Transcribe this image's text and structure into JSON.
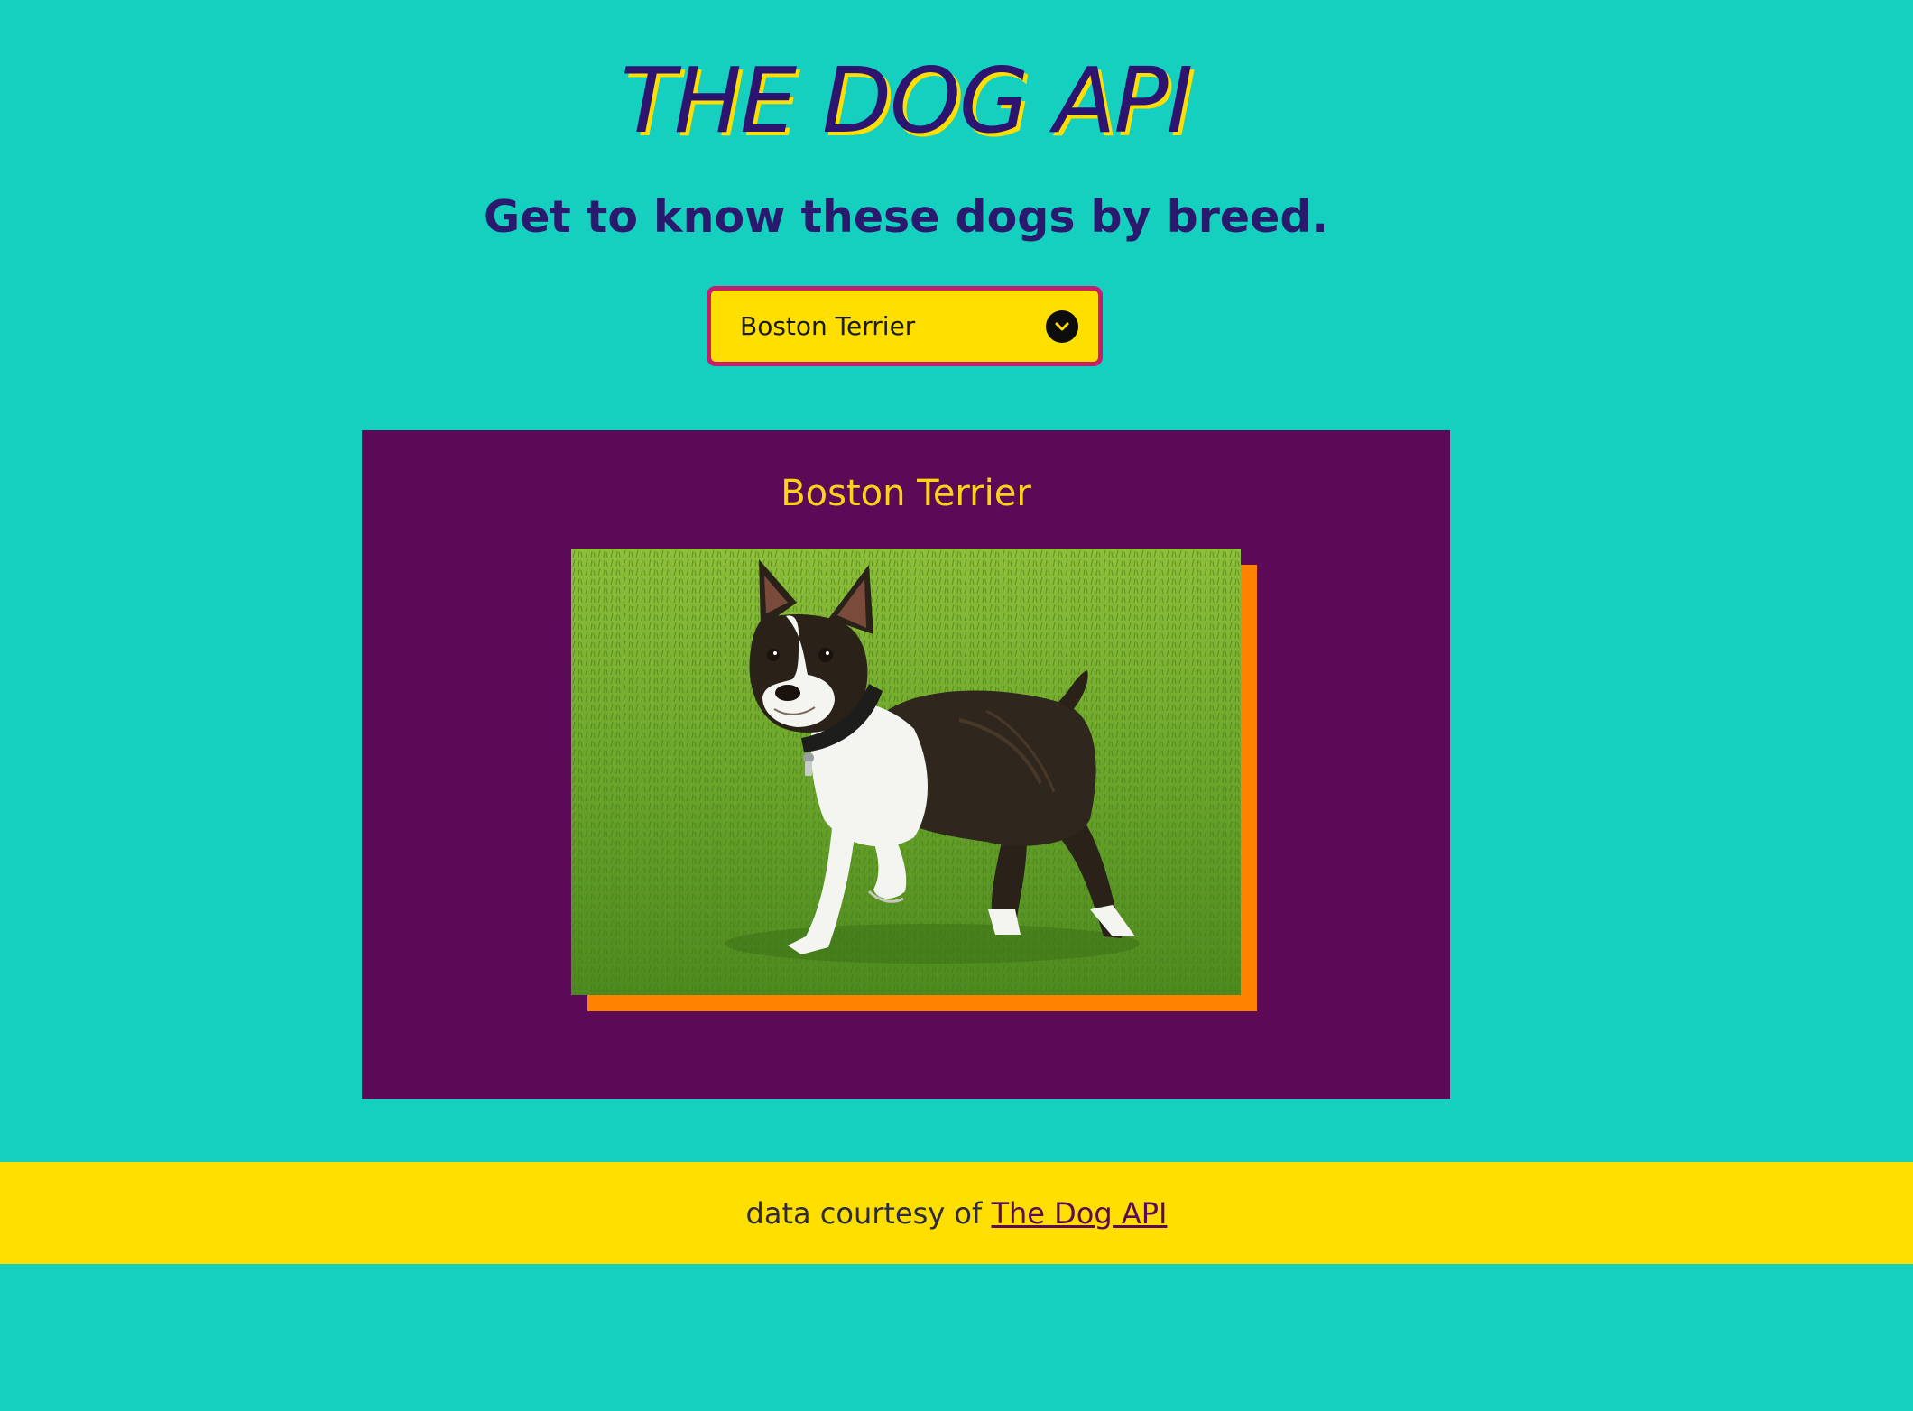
{
  "header": {
    "title": "THE DOG API",
    "subtitle": "Get to know these dogs by breed."
  },
  "breed_select": {
    "selected": "Boston Terrier",
    "icon": "chevron-down-icon"
  },
  "card": {
    "breed_name": "Boston Terrier"
  },
  "footer": {
    "prefix": "data courtesy of",
    "link_text": "The Dog API"
  },
  "colors": {
    "background": "#15cfbf",
    "accent_yellow": "#ffdf00",
    "card_purple": "#5c0a58",
    "title_navy": "#2d1470",
    "select_border": "#c71d6f",
    "photo_shadow": "#ff8200",
    "card_title_gold": "#ffd21a"
  }
}
